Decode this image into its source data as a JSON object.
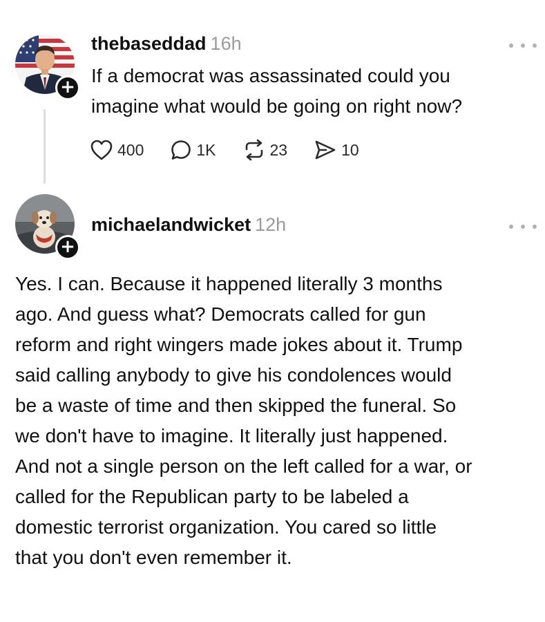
{
  "posts": [
    {
      "username": "thebaseddad",
      "time": "16h",
      "text_lines": [
        "If a democrat was assassinated could you",
        "imagine what would be going on right now?"
      ],
      "avatar_icon": "profile-avatar-man-flag",
      "actions": {
        "likes": "400",
        "replies": "1K",
        "reposts": "23",
        "shares": "10"
      }
    },
    {
      "username": "michaelandwicket",
      "time": "12h",
      "avatar_icon": "profile-avatar-dog",
      "text_lines": [
        "Yes. I can. Because it happened literally 3 months",
        "ago. And guess what? Democrats called for gun",
        "reform and right wingers made jokes about it. Trump",
        "said calling anybody to give his condolences would",
        "be a waste of time and then skipped the funeral. So",
        "we don't have to imagine. It literally just happened.",
        "And not a single person on the left called for a war, or",
        "called for the Republican party to be labeled a",
        "domestic terrorist organization. You cared so little",
        "that you don't even remember it."
      ]
    }
  ],
  "follow_glyph": "+",
  "colors": {
    "text": "#111111",
    "muted": "#9a9a9a",
    "thread_line": "#dcdcdc"
  }
}
